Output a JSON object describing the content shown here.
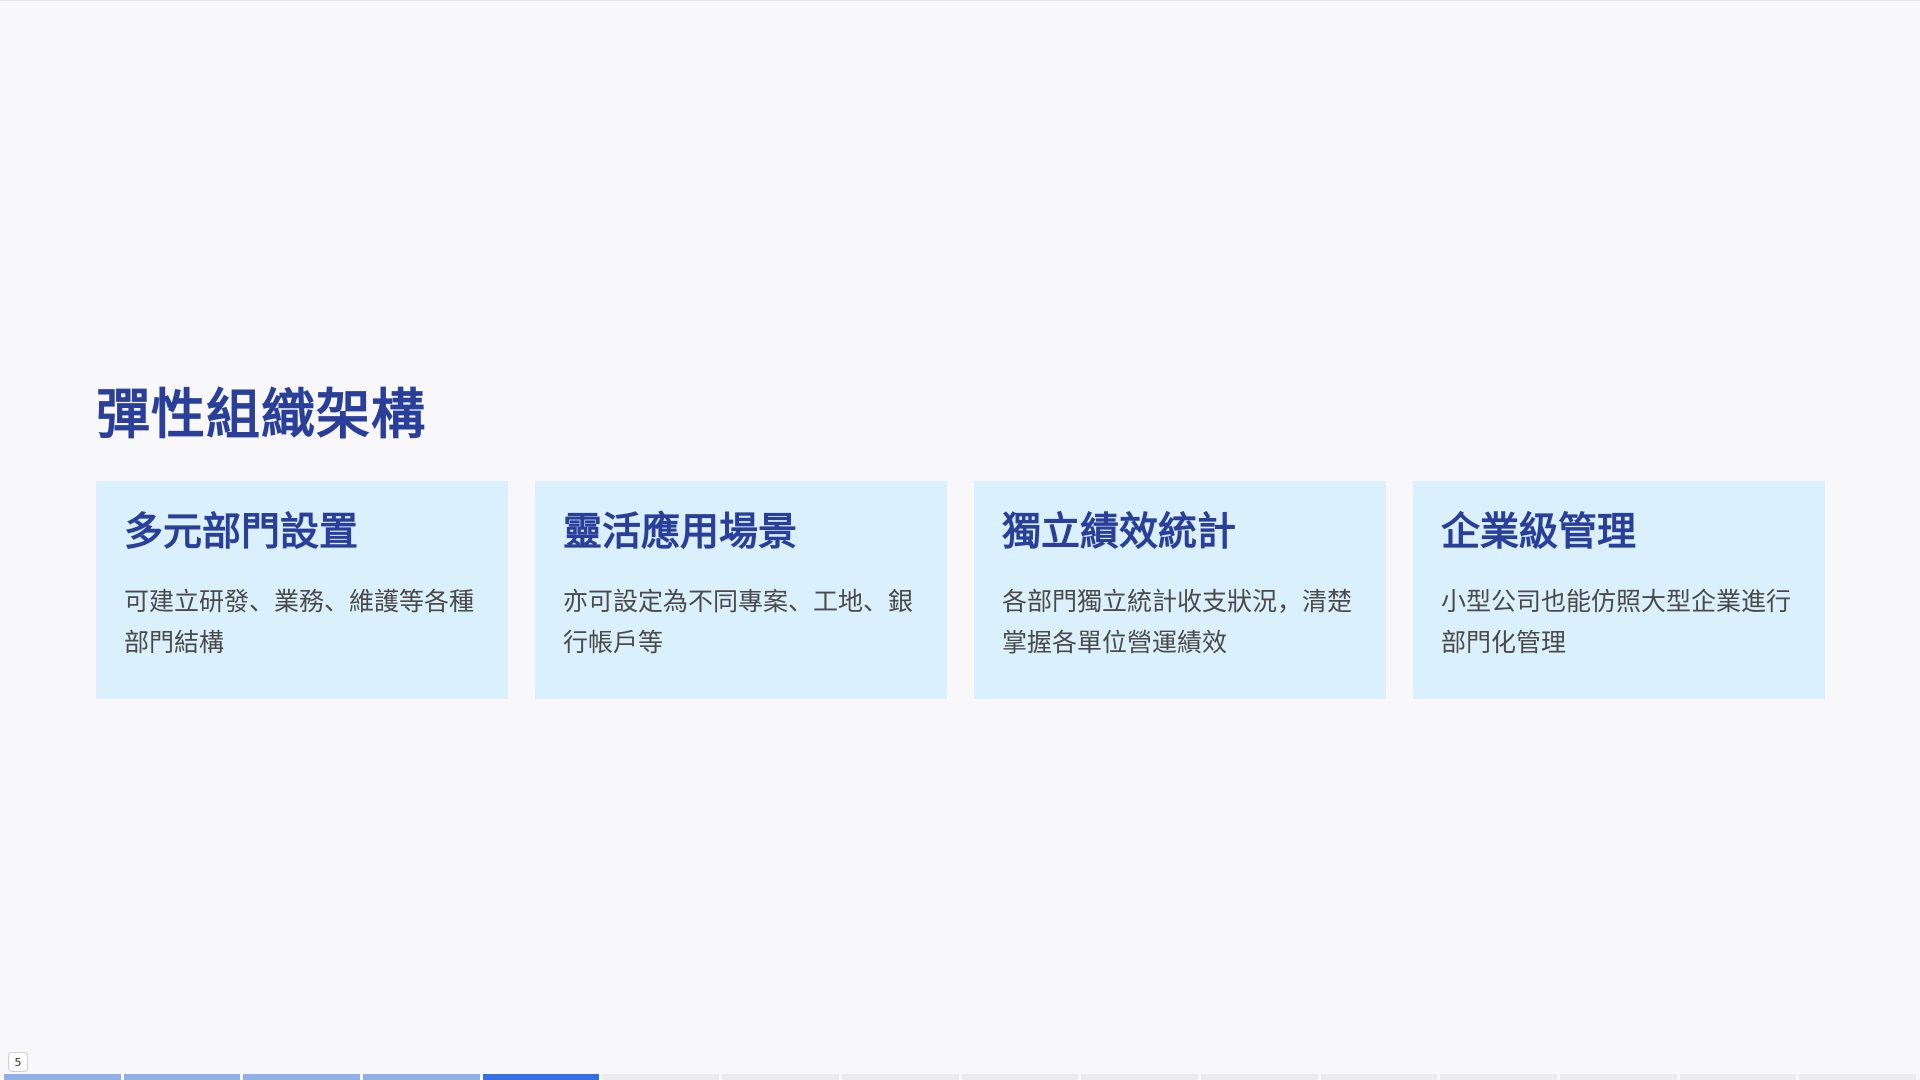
{
  "slide": {
    "title": "彈性組織架構",
    "cards": [
      {
        "title": "多元部門設置",
        "description": "可建立研發、業務、維護等各種部門結構"
      },
      {
        "title": "靈活應用場景",
        "description": "亦可設定為不同專案、工地、銀行帳戶等"
      },
      {
        "title": "獨立績效統計",
        "description": "各部門獨立統計收支狀況，清楚掌握各單位營運績效"
      },
      {
        "title": "企業級管理",
        "description": "小型公司也能仿照大型企業進行部門化管理"
      }
    ]
  },
  "footer": {
    "page_number": "5",
    "progress": {
      "total_slides": 16,
      "current_slide": 5
    }
  },
  "colors": {
    "accent": "#2a3f9a",
    "card_background": "#daf0fd",
    "progress_done": "#8fb0e8",
    "progress_current": "#3470e4"
  }
}
